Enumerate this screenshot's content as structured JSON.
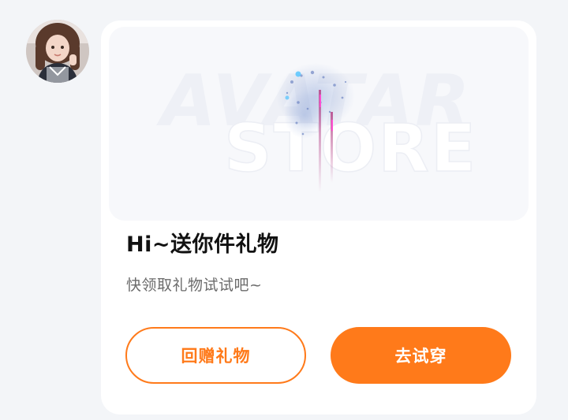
{
  "sender": {
    "avatar_alt": "user-avatar"
  },
  "card": {
    "banner_line1": "AVATAR",
    "banner_line2": "STORE",
    "title": "Hi~送你件礼物",
    "subtitle": "快领取礼物试试吧~",
    "return_gift_label": "回赠礼物",
    "try_on_label": "去试穿"
  },
  "colors": {
    "accent": "#ff7a1a",
    "background": "#f3f5f8",
    "card": "#ffffff"
  }
}
